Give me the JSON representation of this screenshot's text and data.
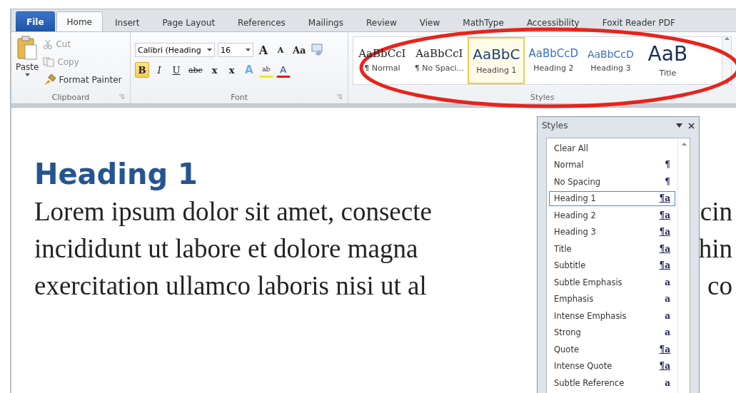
{
  "tabs": [
    {
      "label": "File",
      "kind": "file",
      "selected": false
    },
    {
      "label": "Home",
      "kind": "tab",
      "selected": true
    },
    {
      "label": "Insert",
      "kind": "tab",
      "selected": false
    },
    {
      "label": "Page Layout",
      "kind": "tab",
      "selected": false
    },
    {
      "label": "References",
      "kind": "tab",
      "selected": false
    },
    {
      "label": "Mailings",
      "kind": "tab",
      "selected": false
    },
    {
      "label": "Review",
      "kind": "tab",
      "selected": false
    },
    {
      "label": "View",
      "kind": "tab",
      "selected": false
    },
    {
      "label": "MathType",
      "kind": "tab",
      "selected": false
    },
    {
      "label": "Accessibility",
      "kind": "tab",
      "selected": false
    },
    {
      "label": "Foxit Reader PDF",
      "kind": "tab",
      "selected": false
    }
  ],
  "clipboard": {
    "label": "Clipboard",
    "paste": "Paste",
    "items": [
      {
        "label": "Cut",
        "kind": "cut",
        "disabled": true
      },
      {
        "label": "Copy",
        "kind": "copy",
        "disabled": true
      },
      {
        "label": "Format Painter",
        "kind": "painter",
        "disabled": false
      }
    ]
  },
  "font": {
    "label": "Font",
    "family": "Calibri (Heading",
    "size": "16",
    "row1": [
      {
        "label": "A",
        "kind": "grow"
      },
      {
        "label": "A",
        "kind": "shrink"
      },
      {
        "label": "Aa",
        "kind": "case"
      }
    ],
    "row2": [
      {
        "label": "B",
        "kind": "bold",
        "active": true
      },
      {
        "label": "I",
        "kind": "italic",
        "active": false
      },
      {
        "label": "U",
        "kind": "underline",
        "active": false
      },
      {
        "label": "abc",
        "kind": "strike",
        "active": false
      },
      {
        "label": "x",
        "kind": "sub",
        "active": false
      },
      {
        "label": "x",
        "kind": "sup",
        "active": false
      },
      {
        "label": "A",
        "kind": "effects",
        "active": false
      },
      {
        "label": "ab",
        "kind": "highlight",
        "active": false
      },
      {
        "label": "A",
        "kind": "color",
        "active": false
      }
    ]
  },
  "styles": {
    "label": "Styles",
    "gallery": [
      {
        "preview": "AaBbCcI",
        "label": "¶ Normal",
        "kind": "normal",
        "selected": false
      },
      {
        "preview": "AaBbCcI",
        "label": "¶ No Spaci...",
        "kind": "nospacing",
        "selected": false
      },
      {
        "preview": "AaBbC",
        "label": "Heading 1",
        "kind": "h1",
        "selected": true
      },
      {
        "preview": "AaBbCcD",
        "label": "Heading 2",
        "kind": "h2",
        "selected": false
      },
      {
        "preview": "AaBbCcD",
        "label": "Heading 3",
        "kind": "h3",
        "selected": false
      },
      {
        "preview": "AaB",
        "label": "Title",
        "kind": "title",
        "selected": false
      }
    ]
  },
  "document": {
    "heading": "Heading 1",
    "lines": [
      {
        "left": "Lorem ipsum dolor sit amet, consecte",
        "right": "cin"
      },
      {
        "left": "incididunt ut labore et dolore magna",
        "right": "hin"
      },
      {
        "left": "exercitation ullamco laboris nisi ut al",
        "right": "co"
      }
    ]
  },
  "styles_pane": {
    "title": "Styles",
    "items": [
      {
        "label": "Clear All",
        "kind": "clear",
        "selected": false
      },
      {
        "label": "Normal",
        "symbol": "¶",
        "kind": "paragraph",
        "selected": false
      },
      {
        "label": "No Spacing",
        "symbol": "¶",
        "kind": "paragraph",
        "selected": false
      },
      {
        "label": "Heading 1",
        "symbol": "¶a",
        "kind": "linked",
        "selected": true
      },
      {
        "label": "Heading 2",
        "symbol": "¶a",
        "kind": "linked",
        "selected": false
      },
      {
        "label": "Heading 3",
        "symbol": "¶a",
        "kind": "linked",
        "selected": false
      },
      {
        "label": "Title",
        "symbol": "¶a",
        "kind": "linked",
        "selected": false
      },
      {
        "label": "Subtitle",
        "symbol": "¶a",
        "kind": "linked",
        "selected": false
      },
      {
        "label": "Subtle Emphasis",
        "symbol": "a",
        "kind": "character",
        "selected": false
      },
      {
        "label": "Emphasis",
        "symbol": "a",
        "kind": "character",
        "selected": false
      },
      {
        "label": "Intense Emphasis",
        "symbol": "a",
        "kind": "character",
        "selected": false
      },
      {
        "label": "Strong",
        "symbol": "a",
        "kind": "character",
        "selected": false
      },
      {
        "label": "Quote",
        "symbol": "¶a",
        "kind": "linked",
        "selected": false
      },
      {
        "label": "Intense Quote",
        "symbol": "¶a",
        "kind": "linked",
        "selected": false
      },
      {
        "label": "Subtle Reference",
        "symbol": "a",
        "kind": "character",
        "selected": false
      }
    ]
  }
}
